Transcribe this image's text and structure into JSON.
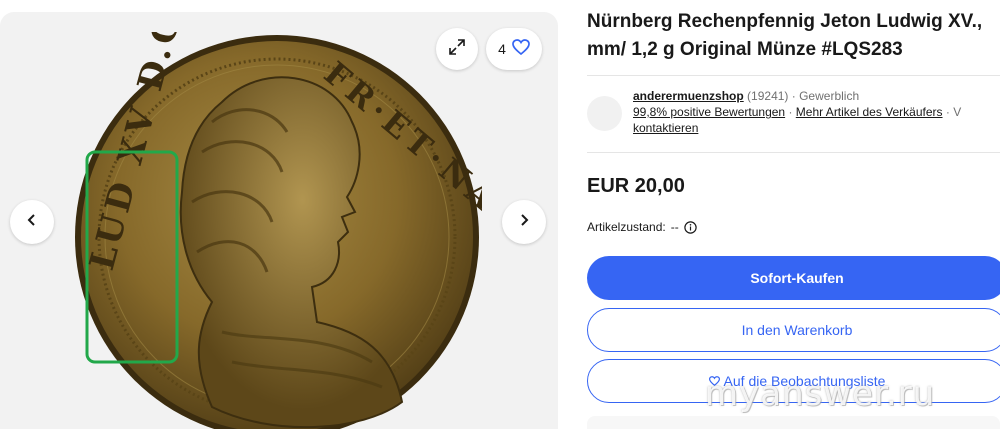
{
  "gallery": {
    "watch_count": "4",
    "coin_legend_left": "LUD XV D.G.",
    "coin_legend_right": "FR·ET·NA·REX"
  },
  "listing": {
    "title_line1": "Nürnberg Rechenpfennig Jeton Ludwig XV.,",
    "title_line2": "mm/ 1,2 g Original Münze #LQS283",
    "price": "EUR 20,00",
    "condition_label": "Artikelzustand:",
    "condition_value": "--"
  },
  "seller": {
    "name": "anderermuenzshop",
    "feedback_count": "(19241)",
    "type": "· Gewerblich",
    "positive_feedback": "99,8% positive Bewertungen",
    "separator": "·",
    "more_items": "Mehr Artikel des Verkäufers",
    "separator2": "· V",
    "contact": "kontaktieren"
  },
  "actions": {
    "buy_now": "Sofort-Kaufen",
    "add_to_cart": "In den Warenkorb",
    "watchlist": "Auf die Beobachtungsliste"
  },
  "watermark": "myanswer.ru",
  "colors": {
    "accent": "#3665f3",
    "highlight_box": "#22a84a",
    "coin_gold": "#8a6f2f"
  },
  "icons": {
    "expand": "expand-icon",
    "watch": "heart-icon",
    "prev": "chevron-left-icon",
    "next": "chevron-right-icon",
    "info": "info-icon"
  }
}
